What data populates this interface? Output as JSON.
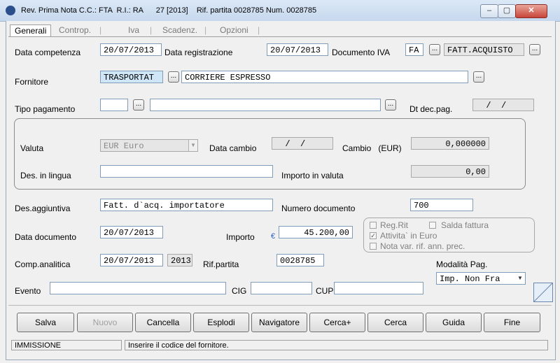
{
  "window": {
    "title": "Rev. Prima Nota C.C.: FTA  R.I.: RA      27 [2013]    Rif. partita 0028785 Num. 0028785"
  },
  "tabs": [
    "Generali",
    "Controp.",
    "Iva",
    "Scadenz.",
    "Opzioni"
  ],
  "form": {
    "data_competenza": {
      "label": "Data competenza",
      "value": "20/07/2013"
    },
    "data_registrazione": {
      "label": "Data registrazione",
      "value": "20/07/2013"
    },
    "documento_iva": {
      "label": "Documento IVA",
      "code": "FA",
      "desc": "FATT.ACQUISTO"
    },
    "fornitore": {
      "label": "Fornitore",
      "code": "TRASPORTAT",
      "desc": "CORRIERE ESPRESSO"
    },
    "tipo_pagamento": {
      "label": "Tipo pagamento",
      "code": "",
      "desc": ""
    },
    "dt_dec_pag": {
      "label": "Dt dec.pag.",
      "value": "  /  /"
    },
    "valuta": {
      "label": "Valuta",
      "value": "EUR Euro"
    },
    "data_cambio": {
      "label": "Data cambio",
      "value": "  /  /"
    },
    "cambio": {
      "label": "Cambio   (EUR)",
      "value": "0,000000"
    },
    "des_lingua": {
      "label": "Des. in lingua",
      "value": ""
    },
    "importo_valuta": {
      "label": "Importo in valuta",
      "value": "0,00"
    },
    "des_aggiuntiva": {
      "label": "Des.aggiuntiva",
      "value": "Fatt. d`acq. importatore"
    },
    "numero_documento": {
      "label": "Numero documento",
      "value": "700"
    },
    "data_documento": {
      "label": "Data documento",
      "value": "20/07/2013"
    },
    "importo": {
      "label": "Importo",
      "currency": "€",
      "value": "45.200,00"
    },
    "checks": [
      {
        "label": "Reg.Rit",
        "checked": false
      },
      {
        "label": "Salda fattura",
        "checked": false
      },
      {
        "label": "Attivita` in Euro",
        "checked": true
      },
      {
        "label": "Nota var. rif. ann. prec.",
        "checked": false
      }
    ],
    "comp_analitica": {
      "label": "Comp.analitica",
      "value": "20/07/2013",
      "year": "2013"
    },
    "rif_partita": {
      "label": "Rif.partita",
      "value": "0028785"
    },
    "modalita_pag": {
      "label": "Modalità Pag.",
      "value": "Imp. Non Fra"
    },
    "evento": {
      "label": "Evento",
      "value": ""
    },
    "cig": {
      "label": "CIG",
      "value": ""
    },
    "cup": {
      "label": "CUP",
      "value": ""
    }
  },
  "buttons": [
    "Salva",
    "Nuovo",
    "Cancella",
    "Esplodi",
    "Navigatore",
    "Cerca+",
    "Cerca",
    "Guida",
    "Fine"
  ],
  "status": {
    "mode": "IMMISSIONE",
    "message": "Inserire il codice del fornitore."
  }
}
